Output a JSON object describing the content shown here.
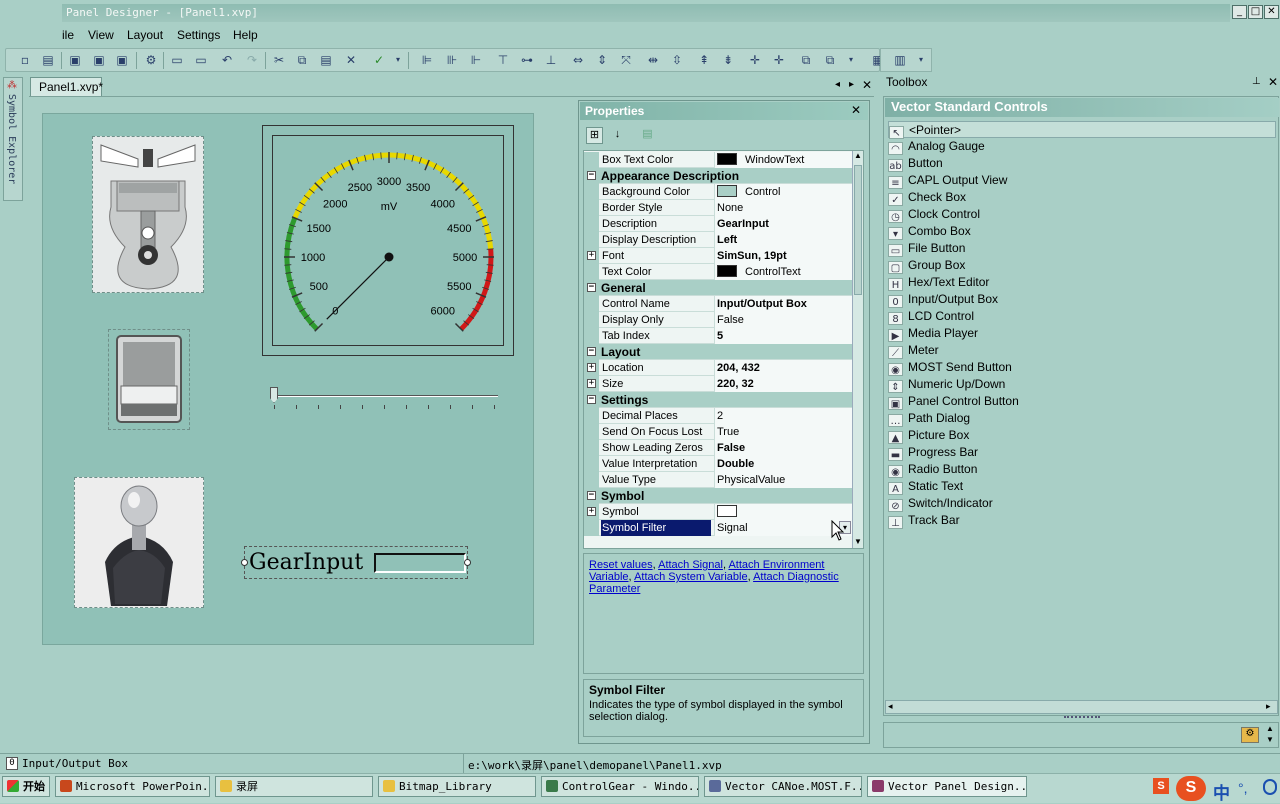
{
  "window": {
    "title": "Panel Designer - [Panel1.xvp]",
    "min": "_",
    "max": "□",
    "close": "✕"
  },
  "menu": [
    "ile",
    "View",
    "Layout",
    "Settings",
    "Help"
  ],
  "left_tab": "Symbol Explorer",
  "doc_tab": "Panel1.xvp*",
  "gauge": {
    "unit": "mV",
    "ticks": [
      "0",
      "500",
      "1000",
      "1500",
      "2000",
      "2500",
      "3000",
      "3500",
      "4000",
      "4500",
      "5000",
      "5500",
      "6000"
    ],
    "min": 0,
    "max": 6000,
    "value": 0,
    "colors": {
      "low": "#2e9a2e",
      "mid": "#e8d800",
      "high": "#d01818"
    }
  },
  "gear_control": {
    "label": "GearInput"
  },
  "properties": {
    "title": "Properties",
    "rows": [
      {
        "kind": "prop",
        "name": "Box Text Color",
        "value": "WindowText",
        "swatch": "#000000"
      },
      {
        "kind": "cat",
        "name": "Appearance Description"
      },
      {
        "kind": "prop",
        "name": "Background Color",
        "value": "Control",
        "swatch": "#a9cfc6"
      },
      {
        "kind": "prop",
        "name": "Border Style",
        "value": "None"
      },
      {
        "kind": "prop",
        "name": "Description",
        "value": "GearInput",
        "bold": true
      },
      {
        "kind": "prop",
        "name": "Display Description",
        "value": "Left",
        "bold": true
      },
      {
        "kind": "prop",
        "name": "Font",
        "value": "SimSun, 19pt",
        "bold": true,
        "expand": true
      },
      {
        "kind": "prop",
        "name": "Text Color",
        "value": "ControlText",
        "swatch": "#000000"
      },
      {
        "kind": "cat",
        "name": "General"
      },
      {
        "kind": "prop",
        "name": "Control Name",
        "value": "Input/Output Box",
        "bold": true
      },
      {
        "kind": "prop",
        "name": "Display Only",
        "value": "False"
      },
      {
        "kind": "prop",
        "name": "Tab Index",
        "value": "5",
        "bold": true
      },
      {
        "kind": "cat",
        "name": "Layout"
      },
      {
        "kind": "prop",
        "name": "Location",
        "value": "204, 432",
        "bold": true,
        "expand": true
      },
      {
        "kind": "prop",
        "name": "Size",
        "value": "220, 32",
        "bold": true,
        "expand": true
      },
      {
        "kind": "cat",
        "name": "Settings"
      },
      {
        "kind": "prop",
        "name": "Decimal Places",
        "value": "2"
      },
      {
        "kind": "prop",
        "name": "Send On Focus Lost",
        "value": "True"
      },
      {
        "kind": "prop",
        "name": "Show Leading Zeros",
        "value": "False",
        "bold": true
      },
      {
        "kind": "prop",
        "name": "Value Interpretation",
        "value": "Double",
        "bold": true
      },
      {
        "kind": "prop",
        "name": "Value Type",
        "value": "PhysicalValue"
      },
      {
        "kind": "cat",
        "name": "Symbol"
      },
      {
        "kind": "prop",
        "name": "Symbol",
        "value": "",
        "swatch": "#ffffff",
        "expand": true
      },
      {
        "kind": "prop",
        "name": "Symbol Filter",
        "value": "Signal",
        "selected": true,
        "dropdown": true
      }
    ],
    "links_text": [
      "Reset values",
      "Attach Signal",
      "Attach Environment Variable",
      "Attach System Variable",
      "Attach Diagnostic Parameter"
    ],
    "help_title": "Symbol Filter",
    "help_text": "Indicates the type of symbol displayed in the symbol selection dialog."
  },
  "toolbox": {
    "title": "Toolbox",
    "group": "Vector Standard Controls",
    "items": [
      {
        "label": "<Pointer>",
        "icon": "pointer-icon",
        "glyph": "↖"
      },
      {
        "label": "Analog Gauge",
        "icon": "analog-gauge-icon",
        "glyph": "◠"
      },
      {
        "label": "Button",
        "icon": "button-icon",
        "glyph": "ab"
      },
      {
        "label": "CAPL Output View",
        "icon": "capl-output-icon",
        "glyph": "≡"
      },
      {
        "label": "Check Box",
        "icon": "check-box-icon",
        "glyph": "✓"
      },
      {
        "label": "Clock Control",
        "icon": "clock-icon",
        "glyph": "◷"
      },
      {
        "label": "Combo Box",
        "icon": "combo-box-icon",
        "glyph": "▾"
      },
      {
        "label": "File Button",
        "icon": "file-button-icon",
        "glyph": "▭"
      },
      {
        "label": "Group Box",
        "icon": "group-box-icon",
        "glyph": "▢"
      },
      {
        "label": "Hex/Text Editor",
        "icon": "hex-editor-icon",
        "glyph": "H"
      },
      {
        "label": "Input/Output Box",
        "icon": "io-box-icon",
        "glyph": "0"
      },
      {
        "label": "LCD Control",
        "icon": "lcd-icon",
        "glyph": "8"
      },
      {
        "label": "Media Player",
        "icon": "media-player-icon",
        "glyph": "▶"
      },
      {
        "label": "Meter",
        "icon": "meter-icon",
        "glyph": "⟋"
      },
      {
        "label": "MOST Send Button",
        "icon": "most-send-icon",
        "glyph": "◉"
      },
      {
        "label": "Numeric Up/Down",
        "icon": "numeric-updown-icon",
        "glyph": "⇕"
      },
      {
        "label": "Panel Control Button",
        "icon": "panel-control-icon",
        "glyph": "▣"
      },
      {
        "label": "Path Dialog",
        "icon": "path-dialog-icon",
        "glyph": "…"
      },
      {
        "label": "Picture Box",
        "icon": "picture-box-icon",
        "glyph": "▲"
      },
      {
        "label": "Progress Bar",
        "icon": "progress-bar-icon",
        "glyph": "▬"
      },
      {
        "label": "Radio Button",
        "icon": "radio-button-icon",
        "glyph": "◉"
      },
      {
        "label": "Static Text",
        "icon": "static-text-icon",
        "glyph": "A"
      },
      {
        "label": "Switch/Indicator",
        "icon": "switch-icon",
        "glyph": "⊘"
      },
      {
        "label": "Track Bar",
        "icon": "track-bar-icon",
        "glyph": "⊥"
      }
    ]
  },
  "status": {
    "control": "Input/Output Box",
    "control_icon_text": "0",
    "path": "e:\\work\\录屏\\panel\\demopanel\\Panel1.xvp"
  },
  "taskbar": {
    "start": "开始",
    "tasks": [
      {
        "label": "Microsoft PowerPoin...",
        "color": "#c8481c"
      },
      {
        "label": "录屏",
        "color": "#e8c040"
      },
      {
        "label": "Bitmap_Library",
        "color": "#e8c040"
      },
      {
        "label": "ControlGear - Windo...",
        "color": "#3a7a4a"
      },
      {
        "label": "Vector CANoe.MOST.F...",
        "color": "#5a6a9a"
      },
      {
        "label": "Vector Panel Design...",
        "color": "#8a3a6a"
      }
    ],
    "ime": "中",
    "ime_extra": "°,"
  }
}
